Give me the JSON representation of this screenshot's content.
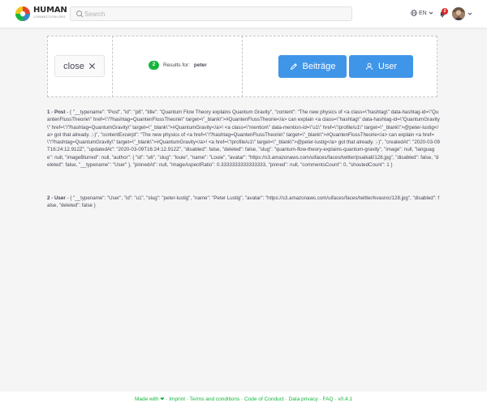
{
  "header": {
    "logo_main": "HUMAN",
    "logo_sub": "CONNECTION.ORG",
    "search_placeholder": "Search",
    "language": "EN",
    "notifications_count": "2"
  },
  "filter": {
    "close_label": "close",
    "results_count": "2",
    "results_label": "Results for:",
    "results_query": "peter",
    "tabs": [
      {
        "label": "Beiträge",
        "icon": "pencil-icon"
      },
      {
        "label": "User",
        "icon": "user-icon"
      }
    ]
  },
  "results": [
    {
      "index": "1",
      "type": "Post",
      "text": "{ \"__typename\": \"Post\", \"id\": \"p8\", \"title\": \"Quantum Flow Theory explains Quantum Gravity\", \"content\": \"The new physics of <a class=\\\"hashtag\\\" data-hashtag-id=\\\"QuantenFlussTheorie\\\" href=\\\"/?hashtag=QuantenFlussTheorie\\\" target=\\\"_blank\\\">#QuantenFlussTheorie</a> can explain <a class=\\\"hashtag\\\" data-hashtag-id=\\\"QuantumGravity\\\" href=\\\"/?hashtag=QuantumGravity\\\" target=\\\"_blank\\\">#QuantumGravity</a>! <a class=\\\"mention\\\" data-mention-id=\\\"u1\\\" href=\\\"/profile/u1\\\" target=\\\"_blank\\\">@peter-lustig</a> got that already. ;-)\", \"contentExcerpt\": \"The new physics of <a href=\\\"/?hashtag=QuantenFlussTheorie\\\" target=\\\"_blank\\\">#QuantenFlussTheorie</a> can explain <a href=\\\"/?hashtag=QuantumGravity\\\" target=\\\"_blank\\\">#QuantumGravity</a>! <a href=\\\"/profile/u1\\\" target=\\\"_blank\\\">@peter-lustig</a> got that already. ;-)\", \"createdAt\": \"2020-03-09T16:24:12.912Z\", \"updatedAt\": \"2020-03-09T16:24:12.912Z\", \"disabled\": false, \"deleted\": false, \"slug\": \"quantum-flow-theory-explains-quantum-gravity\", \"image\": null, \"language\": null, \"imageBlurred\": null, \"author\": { \"id\": \"u6\", \"slug\": \"louie\", \"name\": \"Louie\", \"avatar\": \"https://s3.amazonaws.com/uifaces/faces/twitter/psaikali/128.jpg\", \"disabled\": false, \"deleted\": false, \"__typename\": \"User\" }, \"pinnedAt\": null, \"imageAspectRatio\": 0.3333333333333333, \"pinned\": null, \"commentsCount\": 0, \"shoutedCount\": 1 }"
    },
    {
      "index": "2",
      "type": "User",
      "text": "{ \"__typename\": \"User\", \"id\": \"u1\", \"slug\": \"peter-lustig\", \"name\": \"Peter Lustig\", \"avatar\": \"https://s3.amazonaws.com/uifaces/faces/twitter/kvasnic/128.jpg\", \"disabled\": false, \"deleted\": false }"
    }
  ],
  "footer": {
    "made_with": "Made with",
    "imprint": "Imprint",
    "terms": "Terms and conditions",
    "code_of_conduct": "Code of Conduct",
    "data_privacy": "Data privacy",
    "faq": "FAQ",
    "version": "v0.4.1",
    "separator": "·"
  },
  "colors": {
    "accent_blue": "#3f95e8",
    "brand_green": "#17b53f",
    "badge_red": "#db2828"
  }
}
